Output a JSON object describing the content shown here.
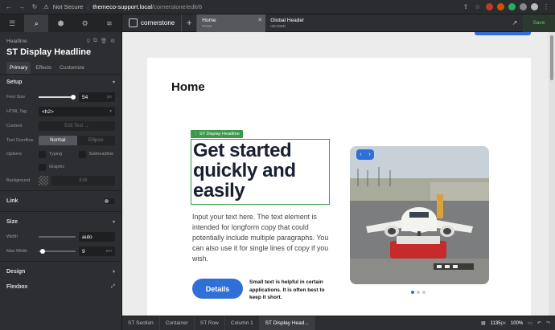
{
  "browser": {
    "security": "Not Secure",
    "host": "themeco-support.local",
    "path": "/cornerstone/edit/6"
  },
  "left_panel": {
    "caption": "Headline",
    "title": "ST Display Headline",
    "subtabs": [
      "Primary",
      "Effects",
      "Customize"
    ],
    "setup": {
      "heading": "Setup",
      "font_size_label": "Font Size",
      "font_size_value": "54",
      "font_size_unit": "px",
      "html_tag_label": "HTML Tag",
      "html_tag_value": "<h2>",
      "content_label": "Content",
      "content_button": "Edit Text →",
      "overflow_label": "Text Overflow",
      "overflow_options": [
        "Normal",
        "Ellipsis"
      ],
      "options_label": "Options",
      "opt_typing": "Typing",
      "opt_subheadline": "Subheadline",
      "opt_graphic": "Graphic",
      "background_label": "Background",
      "background_button": "Edit"
    },
    "link_heading": "Link",
    "size": {
      "heading": "Size",
      "width_label": "Width",
      "width_value": "auto",
      "max_width_label": "Max Width",
      "max_width_value": "9",
      "max_width_unit": "em"
    },
    "design_heading": "Design",
    "flexbox_heading": "Flexbox"
  },
  "builder": {
    "brand": "cornerstone",
    "tabs": [
      {
        "name": "Home",
        "type": "PAGE"
      },
      {
        "name": "Global Header",
        "type": "HEADER"
      }
    ],
    "save": "Save"
  },
  "canvas": {
    "page_title": "Home",
    "badge": "ST Display Headline",
    "headline": "Get started quickly and easily",
    "body": "Input your text here. The text element is intended for longform copy that could potentially include multiple paragraphs. You can also use it for single lines of copy if you wish.",
    "button": "Details",
    "small_text": "Small text is helpful in certain applications. It is often best to keep it short."
  },
  "breadcrumbs": [
    "ST Section",
    "Container",
    "ST Row",
    "Column 1",
    "ST Display Head..."
  ],
  "status": {
    "width": "1135",
    "width_unit": "px",
    "zoom": "100%"
  }
}
